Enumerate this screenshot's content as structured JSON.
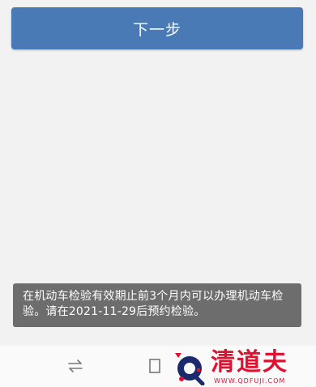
{
  "main": {
    "next_button_label": "下一步"
  },
  "toast": {
    "message": "在机动车检验有效期止前3个月内可以办理机动车检验。请在2021-11-29后预约检验。"
  },
  "nav": {
    "left_icon": "switch-arrows-icon",
    "middle_icon": "recent-apps-icon"
  },
  "watermark": {
    "name": "清道夫",
    "url": "WWW.QDFUJI.COM"
  },
  "colors": {
    "accent": "#4a7ab5",
    "background": "#f2f2f2",
    "toast_bg": "#686868",
    "watermark_red": "#e0102f"
  }
}
